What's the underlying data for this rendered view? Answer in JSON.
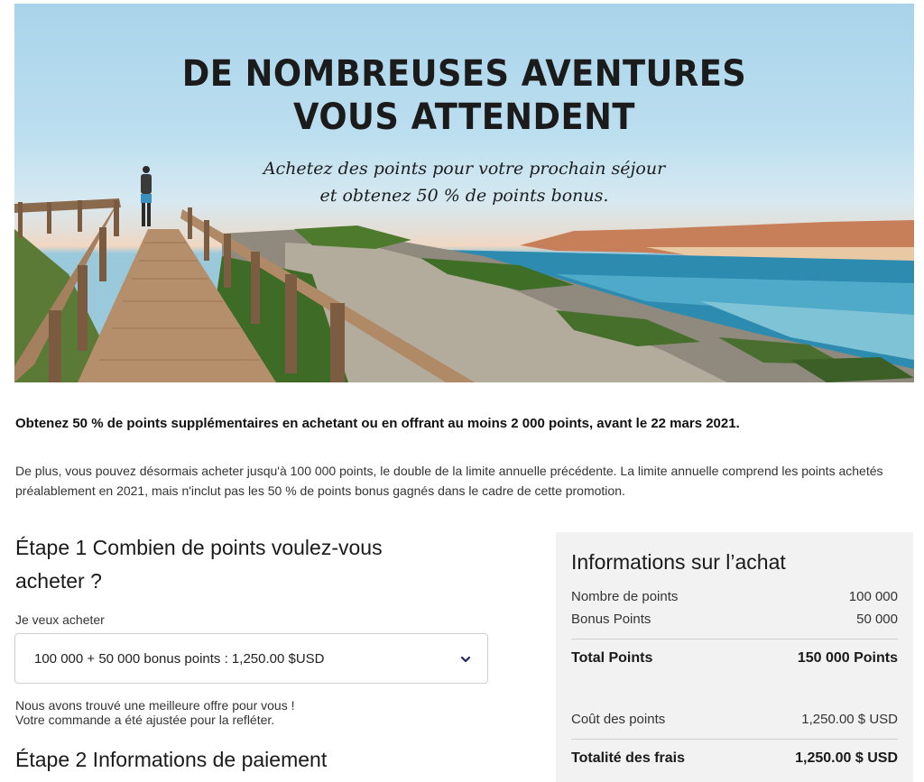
{
  "hero": {
    "title_line1": "DE NOMBREUSES AVENTURES",
    "title_line2": "VOUS ATTENDENT",
    "subtitle_line1": "Achetez des points pour votre prochain séjour",
    "subtitle_line2": "et obtenez 50  % de points bonus."
  },
  "promo": {
    "headline": "Obtenez 50 % de points supplémentaires en achetant ou en offrant au moins 2 000 points, avant le 22 mars 2021.",
    "body": "De plus, vous pouvez désormais acheter jusqu'à 100 000 points, le double de la limite annuelle précédente. La limite annuelle comprend les points achetés préalablement en 2021, mais n'inclut pas les 50 % de points bonus gagnés dans le cadre de cette promotion."
  },
  "step1": {
    "title": "Étape 1 Combien de points voulez-vous acheter ?",
    "label": "Je veux acheter",
    "selected_option": "100 000 + 50 000 bonus points : 1,250.00 $USD",
    "notice_line1": "Nous avons trouvé une meilleure offre pour vous !",
    "notice_line2": "Votre commande a été ajustée pour la refléter."
  },
  "step2": {
    "title": "Étape 2 Informations de paiement"
  },
  "summary": {
    "title": "Informations sur l’achat",
    "points_label": "Nombre de points",
    "points_value": "100 000",
    "bonus_label": "Bonus Points",
    "bonus_value": "50 000",
    "total_points_label": "Total Points",
    "total_points_value": "150 000 Points",
    "cost_label": "Coût des points",
    "cost_value": "1,250.00 $ USD",
    "total_fees_label": "Totalité des frais",
    "total_fees_value": "1,250.00 $ USD"
  }
}
